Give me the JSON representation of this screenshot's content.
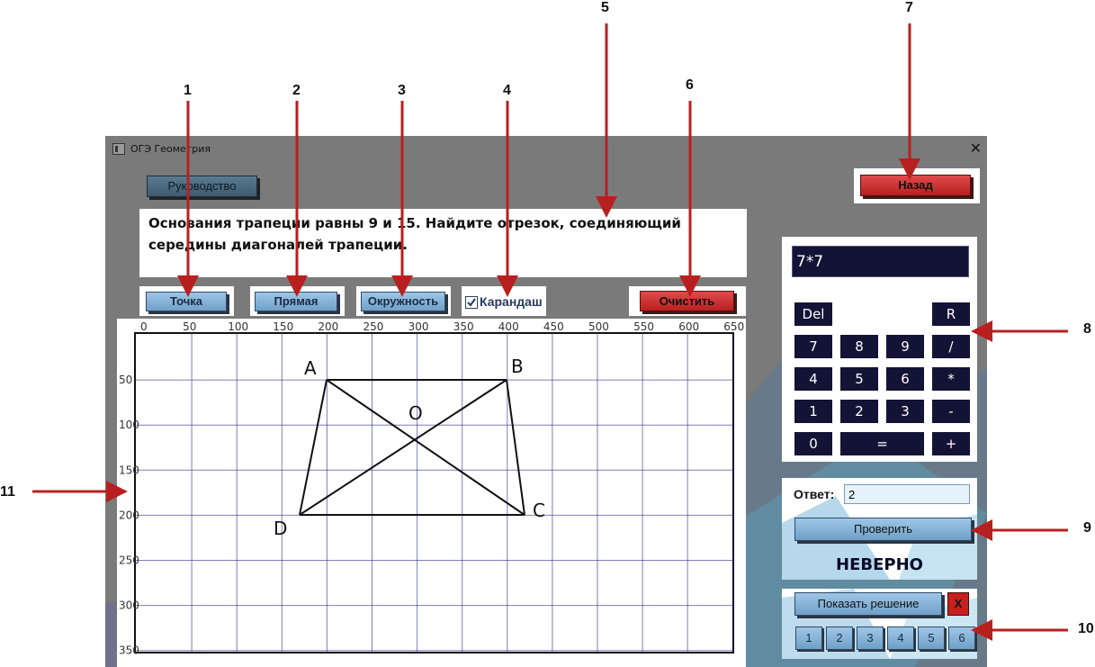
{
  "callouts": [
    "1",
    "2",
    "3",
    "4",
    "5",
    "6",
    "7",
    "8",
    "9",
    "10",
    "11"
  ],
  "window": {
    "title": "ОГЭ Геометрия",
    "close": "✕"
  },
  "toolbar": {
    "guide": "Руководство",
    "back": "Назад",
    "point": "Точка",
    "line": "Прямая",
    "circle": "Окружность",
    "pencil": "Карандаш",
    "clear": "Очистить"
  },
  "question": "Основания трапеции равны 9 и 15. Найдите отрезок, соединяющий середины диагоналей трапеции.",
  "canvas": {
    "x_ticks": [
      "0",
      "50",
      "100",
      "150",
      "200",
      "250",
      "300",
      "350",
      "400",
      "450",
      "500",
      "550",
      "600",
      "650"
    ],
    "y_ticks": [
      "50",
      "100",
      "150",
      "200",
      "250",
      "300",
      "350"
    ],
    "labels": {
      "A": "A",
      "B": "B",
      "C": "C",
      "D": "D",
      "O": "O"
    }
  },
  "calculator": {
    "display": "7*7",
    "keys": {
      "del": "Del",
      "reset": "R",
      "k7": "7",
      "k8": "8",
      "k9": "9",
      "div": "/",
      "k4": "4",
      "k5": "5",
      "k6": "6",
      "mul": "*",
      "k1": "1",
      "k2": "2",
      "k3": "3",
      "sub": "-",
      "k0": "0",
      "eq": "=",
      "add": "+"
    }
  },
  "answer": {
    "label": "Ответ:",
    "value": "2",
    "check": "Проверить",
    "result": "НЕВЕРНО"
  },
  "solution": {
    "show": "Показать решение",
    "close": "X",
    "steps": [
      "1",
      "2",
      "3",
      "4",
      "5",
      "6"
    ]
  }
}
